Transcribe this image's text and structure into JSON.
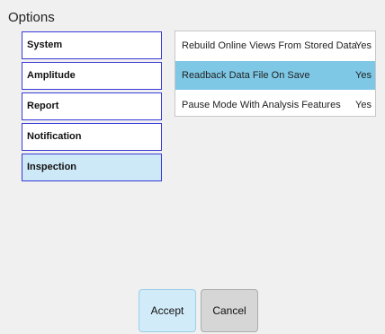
{
  "dialog": {
    "title": "Options"
  },
  "categories": [
    {
      "label": "System",
      "selected": false
    },
    {
      "label": "Amplitude",
      "selected": false
    },
    {
      "label": "Report",
      "selected": false
    },
    {
      "label": "Notification",
      "selected": false
    },
    {
      "label": "Inspection",
      "selected": true
    }
  ],
  "settings": [
    {
      "label": "Rebuild Online Views From Stored Data",
      "value": "Yes",
      "selected": false
    },
    {
      "label": "Readback Data File On Save",
      "value": "Yes",
      "selected": true
    },
    {
      "label": "Pause Mode With Analysis Features",
      "value": "Yes",
      "selected": false
    }
  ],
  "buttons": {
    "accept_label": "Accept",
    "cancel_label": "Cancel"
  },
  "colors": {
    "selected_category": "#cde8f7",
    "selected_setting": "#7ec8e6",
    "category_border": "#3a3ad8"
  }
}
